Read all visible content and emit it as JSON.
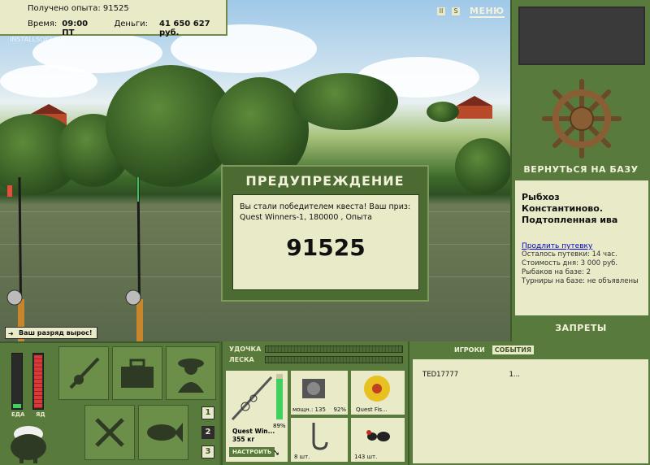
{
  "top_info": {
    "exp_label": "Получено опыта: 91525",
    "time_label": "Время:",
    "time_value": "09:00 ПТ",
    "money_label": "Деньги:",
    "money_value": "41 650 627 руб."
  },
  "watermark": "INSTALLSOFT.RU",
  "menu_label": "МЕНЮ",
  "warning": {
    "title": "ПРЕДУПРЕЖДЕНИЕ",
    "message": "Вы стали победителем квеста! Ваш приз: Quest Winners-1, 180000 , Опыта",
    "value": "91525"
  },
  "rank_toast": "Ваш разряд вырос!",
  "right_panel": {
    "return_label": "ВЕРНУТЬСЯ НА БАЗУ",
    "lake_title": "Рыбхоз Константиново. Подтопленная ива",
    "extend_link": "Продлить путевку",
    "stats": [
      "Осталось путевки: 14 час.",
      "Стоимость дня: 3 000 руб.",
      "Рыбаков на базе: 2",
      "Турниры на базе: не объявлены"
    ],
    "bans_label": "ЗАПРЕТЫ"
  },
  "gauges": {
    "food_label": "ЕДА",
    "food_level": 0.08,
    "poison_label": "ЯД",
    "poison_level": 0.95
  },
  "num_buttons": [
    "1",
    "2",
    "3"
  ],
  "tackle": {
    "rod_label": "УДОЧКА",
    "line_label": "ЛЕСКА",
    "rod_name": "Quest Win...",
    "rod_weight": "355 кг",
    "rod_percent": "89%",
    "setup_label": "НАСТРОИТЬ",
    "reel_caption": "мощн.: 135",
    "reel_percent": "92%",
    "line_caption": "Quest Fis...",
    "hook_caption": "8 шт.",
    "bait_caption": "143 шт."
  },
  "chat": {
    "tab_players": "ИГРОКИ",
    "tab_events": "СОБЫТИЯ",
    "players": [
      {
        "name": "TED17777",
        "value": "1..."
      }
    ]
  }
}
